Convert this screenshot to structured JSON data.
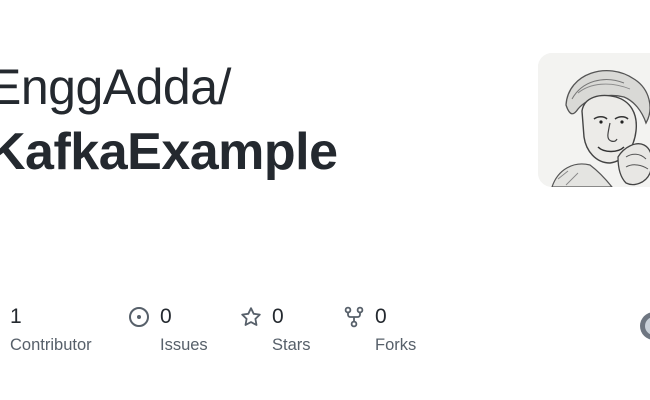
{
  "repo": {
    "owner": "EnggAdda/",
    "name": "KafkaExample"
  },
  "stats": [
    {
      "value": "1",
      "label": "Contributor",
      "icon": "people-icon"
    },
    {
      "value": "0",
      "label": "Issues",
      "icon": "issue-opened-icon"
    },
    {
      "value": "0",
      "label": "Stars",
      "icon": "star-icon"
    },
    {
      "value": "0",
      "label": "Forks",
      "icon": "fork-icon"
    }
  ],
  "colors": {
    "title": "#24292f",
    "label": "#57606a",
    "icon": "#57606a"
  }
}
